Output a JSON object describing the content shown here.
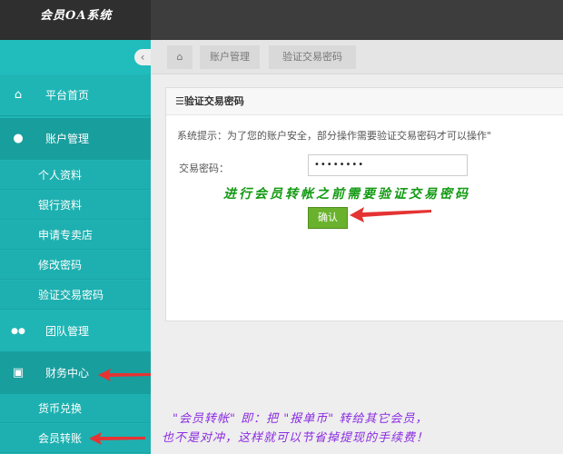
{
  "app": {
    "title": "会员OA系统"
  },
  "sidebar": {
    "collapse_glyph": "‹",
    "items": [
      {
        "label": "平台首页",
        "icon": "home-icon",
        "glyph": "⌂"
      },
      {
        "label": "账户管理",
        "icon": "user-icon",
        "glyph": "●"
      },
      {
        "label": "个人资料"
      },
      {
        "label": "银行资料"
      },
      {
        "label": "申请专卖店"
      },
      {
        "label": "修改密码"
      },
      {
        "label": "验证交易密码"
      },
      {
        "label": "团队管理",
        "icon": "users-icon",
        "glyph": "●●"
      },
      {
        "label": "财务中心",
        "icon": "money-icon",
        "glyph": "▣"
      },
      {
        "label": "货币兑换"
      },
      {
        "label": "会员转账"
      }
    ]
  },
  "breadcrumb": {
    "home_icon": "home-icon",
    "home_glyph": "⌂",
    "items": [
      "账户管理",
      "验证交易密码"
    ]
  },
  "panel": {
    "title": "☰验证交易密码",
    "tip": "系统提示：为了您的账户安全，部分操作需要验证交易密码才可以操作\"",
    "field_label": "交易密码：",
    "field_value": "••••••••",
    "confirm_label": "确认"
  },
  "annotations": {
    "note1": "进行会员转帐之前需要验证交易密码",
    "note2": "\"会员转帐\" 即：把 \"报单币\" 转给其它会员，",
    "note3": "也不是对冲，这样就可以节省掉提现的手续费！"
  },
  "colors": {
    "sidebar": "#1fb5b5",
    "topbar": "#3d3d3d",
    "confirm": "#6ab22e",
    "arrow": "#e53333",
    "note_green": "#139a13",
    "note_purple": "#8a2be2"
  }
}
